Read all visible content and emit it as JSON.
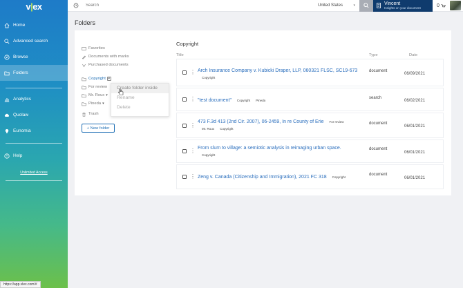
{
  "sidebar": {
    "logo": {
      "pre": "v",
      "dot": "|",
      "post": "ex"
    },
    "items": [
      {
        "label": "Home",
        "icon": "home-icon"
      },
      {
        "label": "Advanced search",
        "icon": "search-icon"
      },
      {
        "label": "Browse",
        "icon": "compass-icon"
      },
      {
        "label": "Folders",
        "icon": "folder-icon",
        "active": true
      }
    ],
    "items2": [
      {
        "label": "Analytics",
        "icon": "chart-icon"
      },
      {
        "label": "Quolaw",
        "icon": "cloud-icon"
      },
      {
        "label": "Eunomia",
        "icon": "bulb-icon"
      }
    ],
    "help": "Help",
    "unlimited_access": "Unlimited Access"
  },
  "topbar": {
    "search_placeholder": "Search",
    "country": "United States",
    "user_name": "Vincent",
    "user_sub": "Insights on your document",
    "cart_count": "0"
  },
  "page_title": "Folders",
  "left_nav": {
    "favorites": "Favorites",
    "documents_with_marks": "Documents with marks",
    "purchased_documents": "Purchased documents",
    "folders": [
      {
        "label": "Copyright",
        "selected": true
      },
      {
        "label": "For review"
      },
      {
        "label": "Mr. Roux"
      },
      {
        "label": "Pineda"
      }
    ],
    "trash": "Trash",
    "new_folder": "+ New folder"
  },
  "context_menu": {
    "items": [
      "Create folder inside",
      "Rename",
      "Delete"
    ]
  },
  "content": {
    "section_title": "Copyright",
    "headers": {
      "title": "Title",
      "type": "Type",
      "date": "Date"
    },
    "rows": [
      {
        "title": "Arch Insurance Company v. Kubicki Draper, LLP, 060321 FLSC, SC19-673",
        "tags": [
          "Copyright"
        ],
        "type": "document",
        "date": "06/09/2021"
      },
      {
        "title": "\"test document\"",
        "tags": [
          "Copyright",
          "Pineda"
        ],
        "type": "search",
        "date": "06/02/2021"
      },
      {
        "title": "473 F.3d 413 (2nd Cir. 2007), 06-2459, In re County of Erie",
        "tags": [
          "For review"
        ],
        "tags2": [
          "Mr. Roux",
          "Copyright"
        ],
        "type": "document",
        "date": "06/01/2021"
      },
      {
        "title": "From slum to village: a semiotic analysis in reimaging urban space.",
        "tags2": [
          "Copyright"
        ],
        "type": "document",
        "date": "06/01/2021"
      },
      {
        "title": "Zeng v. Canada (Citizenship and Immigration), 2021 FC 318",
        "tags": [
          "Copyright"
        ],
        "type": "document",
        "date": "06/01/2021"
      }
    ]
  },
  "status_url": "https://app.vlex.com/#"
}
